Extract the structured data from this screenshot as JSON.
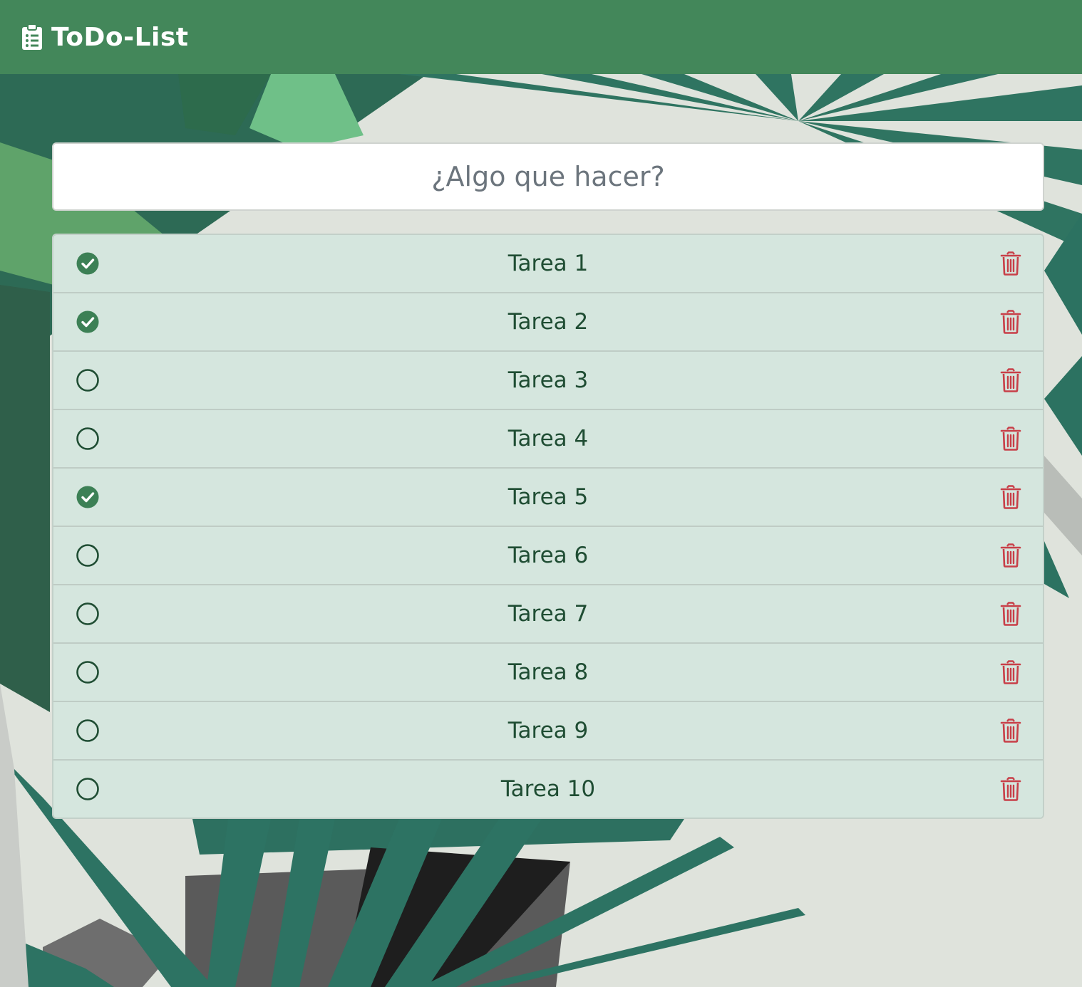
{
  "app": {
    "title": "ToDo-List",
    "icon": "clipboard-list-icon"
  },
  "new_task": {
    "placeholder": "¿Algo que hacer?",
    "value": ""
  },
  "tasks": [
    {
      "label": "Tarea 1",
      "done": true
    },
    {
      "label": "Tarea 2",
      "done": true
    },
    {
      "label": "Tarea 3",
      "done": false
    },
    {
      "label": "Tarea 4",
      "done": false
    },
    {
      "label": "Tarea 5",
      "done": true
    },
    {
      "label": "Tarea 6",
      "done": false
    },
    {
      "label": "Tarea 7",
      "done": false
    },
    {
      "label": "Tarea 8",
      "done": false
    },
    {
      "label": "Tarea 9",
      "done": false
    },
    {
      "label": "Tarea 10",
      "done": false
    }
  ],
  "icons": {
    "done": "check-circle-icon",
    "pending": "circle-icon",
    "delete": "trash-icon"
  },
  "colors": {
    "navbar": "#43875a",
    "row_background": "#d5e6de",
    "task_text": "#1f4d33",
    "check_done": "#3c8055",
    "delete": "#c83f48"
  }
}
